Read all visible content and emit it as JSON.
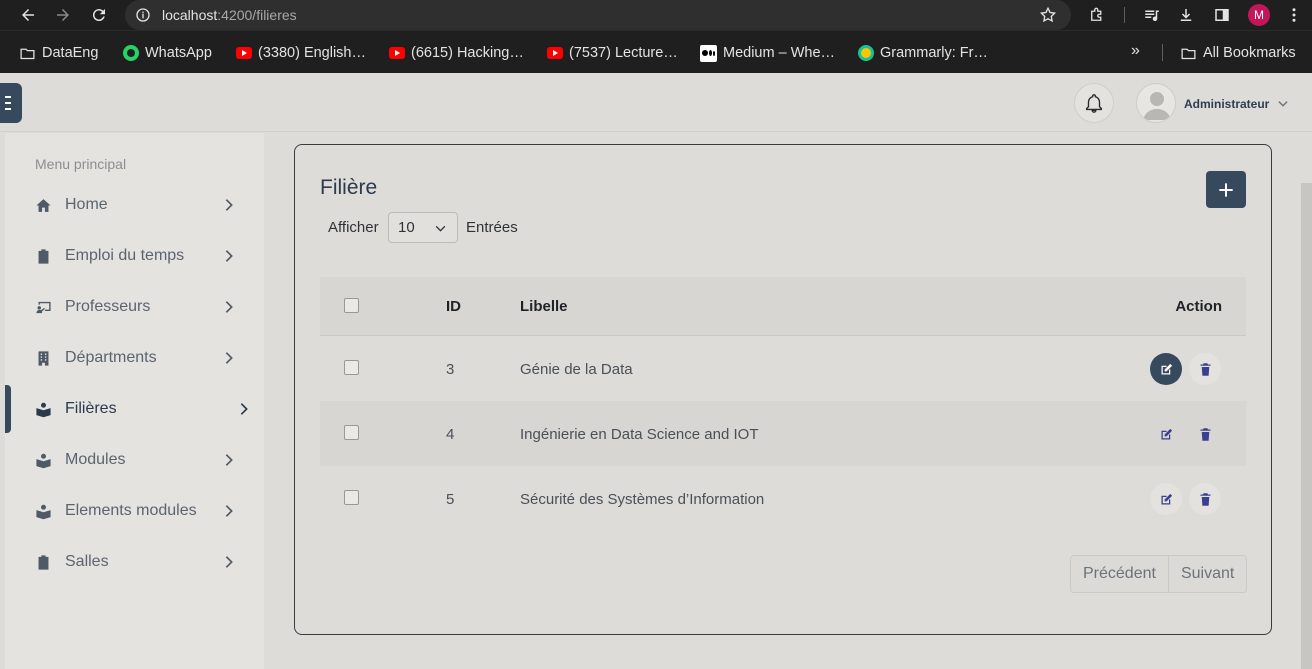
{
  "browser": {
    "url_host": "localhost",
    "url_path": ":4200/filieres",
    "profile_initial": "M",
    "bookmarks": [
      {
        "label": "DataEng",
        "icon": "folder-icon"
      },
      {
        "label": "WhatsApp",
        "icon": "whatsapp-icon"
      },
      {
        "label": "(3380) English…",
        "icon": "youtube-icon"
      },
      {
        "label": "(6615) Hacking…",
        "icon": "youtube-icon"
      },
      {
        "label": "(7537) Lecture…",
        "icon": "youtube-icon"
      },
      {
        "label": "Medium – Whe…",
        "icon": "medium-icon"
      },
      {
        "label": "Grammarly: Fr…",
        "icon": "grammarly-icon"
      }
    ],
    "more_bookmarks": "»",
    "all_bookmarks": "All Bookmarks"
  },
  "header": {
    "user_name": "Administrateur"
  },
  "sidebar": {
    "title": "Menu principal",
    "items": [
      {
        "label": "Home",
        "icon": "home-icon"
      },
      {
        "label": "Emploi du temps",
        "icon": "clipboard-icon"
      },
      {
        "label": "Professeurs",
        "icon": "chalkboard-teacher-icon"
      },
      {
        "label": "Départments",
        "icon": "building-icon"
      },
      {
        "label": "Filières",
        "icon": "book-reader-icon",
        "active": true
      },
      {
        "label": "Modules",
        "icon": "book-reader-icon"
      },
      {
        "label": "Elements modules",
        "icon": "book-reader-icon"
      },
      {
        "label": "Salles",
        "icon": "clipboard-icon"
      }
    ]
  },
  "main": {
    "title": "Filière",
    "show_label": "Afficher",
    "entries_value": "10",
    "entries_label": "Entrées",
    "table": {
      "headers": {
        "id": "ID",
        "libelle": "Libelle",
        "action": "Action"
      },
      "rows": [
        {
          "id": "3",
          "libelle": "Génie de la Data"
        },
        {
          "id": "4",
          "libelle": "Ingénierie en Data Science and IOT"
        },
        {
          "id": "5",
          "libelle": "Sécurité des Systèmes d’Information"
        }
      ]
    },
    "pagination": {
      "prev": "Précédent",
      "next": "Suivant"
    }
  },
  "colors": {
    "primary": "#36495d",
    "action_icon": "#3b3f8f",
    "background": "#dedcd9"
  }
}
